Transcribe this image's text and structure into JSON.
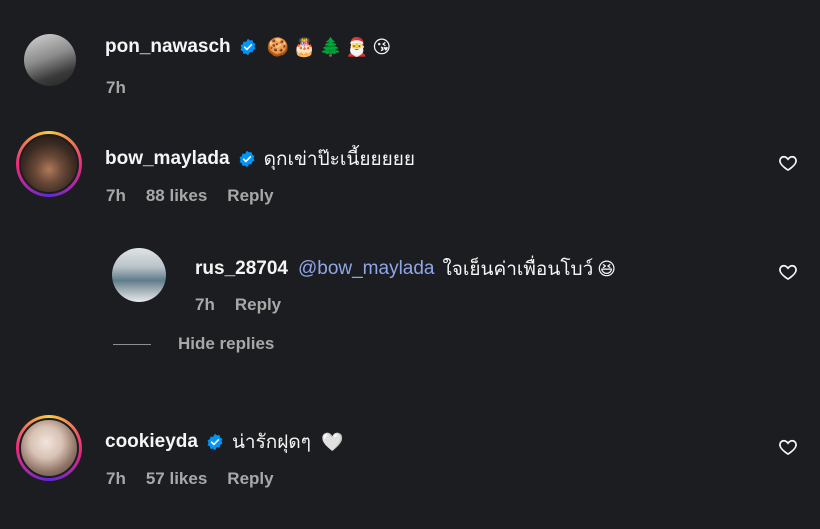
{
  "comments": [
    {
      "username": "pon_nawasch",
      "text": "",
      "emojis": [
        "🍪",
        "🎂",
        "🌲",
        "🎅",
        "😘"
      ],
      "time": "7h"
    },
    {
      "username": "bow_maylada",
      "text": "ดุกเข่าป๊ะเนี้ยยยยย",
      "time": "7h",
      "likes": "88 likes",
      "reply": "Reply"
    },
    {
      "username": "cookieyda",
      "text": "น่ารักฝุดๆ",
      "emoji": "🤍",
      "time": "7h",
      "likes": "57 likes",
      "reply": "Reply"
    }
  ],
  "reply": {
    "username": "rus_28704",
    "mention": "@bow_maylada",
    "text": "ใจเย็นค่าเพื่อนโบว์",
    "emoji": "😆",
    "time": "7h",
    "reply": "Reply"
  },
  "hide_replies": "Hide replies",
  "colors": {
    "background": "#1c1d20",
    "verified": "#0095f6",
    "mention": "#8fa6e8",
    "muted": "#a8a8a8"
  }
}
